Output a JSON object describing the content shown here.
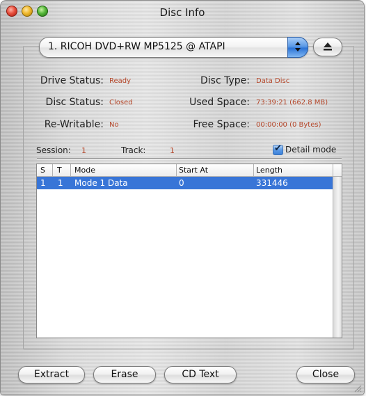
{
  "window": {
    "title": "Disc Info"
  },
  "device": {
    "selected": "1. RICOH DVD+RW MP5125 @ ATAPI"
  },
  "info": {
    "drive_status": {
      "label": "Drive Status:",
      "value": "Ready"
    },
    "disc_status": {
      "label": "Disc Status:",
      "value": "Closed"
    },
    "rewritable": {
      "label": "Re-Writable:",
      "value": "No"
    },
    "disc_type": {
      "label": "Disc Type:",
      "value": "Data Disc"
    },
    "used_space": {
      "label": "Used Space:",
      "value": "73:39:21 (662.8 MB)"
    },
    "free_space": {
      "label": "Free Space:",
      "value": "00:00:00 (0 Bytes)"
    }
  },
  "session": {
    "label": "Session:",
    "value": "1"
  },
  "track": {
    "label": "Track:",
    "value": "1"
  },
  "detail_mode": {
    "label": "Detail mode",
    "checked": true
  },
  "table": {
    "headers": [
      "S",
      "T",
      "Mode",
      "Start At",
      "Length"
    ],
    "rows": [
      [
        "1",
        "1",
        "Mode 1 Data",
        "0",
        "331446"
      ]
    ]
  },
  "buttons": {
    "extract": "Extract",
    "erase": "Erase",
    "cd_text": "CD Text",
    "close": "Close"
  },
  "colors": {
    "value_text": "#b5472a",
    "selection": "#3875d7",
    "aqua_blue": "#2d74d6"
  },
  "icons": {
    "eject": "eject-icon",
    "checkbox": "checkmark-icon",
    "resize": "resize-grip-icon"
  }
}
